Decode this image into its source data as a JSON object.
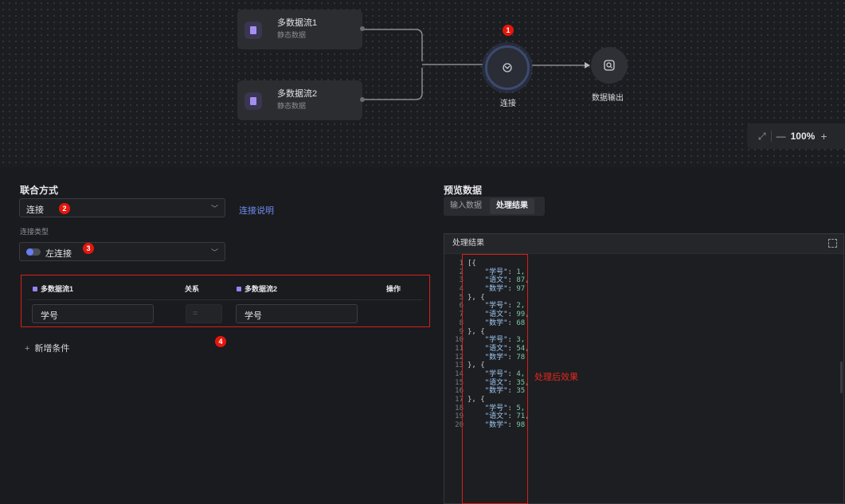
{
  "canvas": {
    "nodes": [
      {
        "title": "多数据流1",
        "subtitle": "静态数据"
      },
      {
        "title": "多数据流2",
        "subtitle": "静态数据"
      }
    ],
    "join_label": "连接",
    "output_label": "数据输出",
    "zoom": "100%",
    "zoom_minus": "—",
    "zoom_plus": "+",
    "fit_icon": "⤢"
  },
  "badges": [
    "1",
    "2",
    "3",
    "4"
  ],
  "left": {
    "union_title": "联合方式",
    "union_value": "连接",
    "union_help": "连接说明",
    "join_type_label": "连接类型",
    "join_type_value": "左连接",
    "conditions": {
      "headers": {
        "left": "多数据流1",
        "relation": "关系",
        "right": "多数据流2",
        "action": "操作"
      },
      "row": {
        "left": "学号",
        "relation": "=",
        "right": "学号"
      }
    },
    "add_condition": "新增条件",
    "add_plus": "+"
  },
  "right": {
    "preview_title": "预览数据",
    "tabs": [
      "输入数据",
      "处理结果"
    ],
    "result_title": "处理结果",
    "annotation": "处理后效果"
  },
  "code_lines": [
    {
      "n": "1",
      "t": "[{"
    },
    {
      "n": "2",
      "k": "\"学号\"",
      "v": "1,"
    },
    {
      "n": "3",
      "k": "\"语文\"",
      "v": "87,"
    },
    {
      "n": "4",
      "k": "\"数学\"",
      "v": "97"
    },
    {
      "n": "5",
      "t": "}, {"
    },
    {
      "n": "6",
      "k": "\"学号\"",
      "v": "2,"
    },
    {
      "n": "7",
      "k": "\"语文\"",
      "v": "99,"
    },
    {
      "n": "8",
      "k": "\"数学\"",
      "v": "68"
    },
    {
      "n": "9",
      "t": "}, {"
    },
    {
      "n": "10",
      "k": "\"学号\"",
      "v": "3,"
    },
    {
      "n": "11",
      "k": "\"语文\"",
      "v": "54,"
    },
    {
      "n": "12",
      "k": "\"数学\"",
      "v": "78"
    },
    {
      "n": "13",
      "t": "}, {"
    },
    {
      "n": "14",
      "k": "\"学号\"",
      "v": "4,"
    },
    {
      "n": "15",
      "k": "\"语文\"",
      "v": "35,"
    },
    {
      "n": "16",
      "k": "\"数学\"",
      "v": "35"
    },
    {
      "n": "17",
      "t": "}, {"
    },
    {
      "n": "18",
      "k": "\"学号\"",
      "v": "5,"
    },
    {
      "n": "19",
      "k": "\"语文\"",
      "v": "71,"
    },
    {
      "n": "20",
      "k": "\"数学\"",
      "v": "98"
    }
  ]
}
